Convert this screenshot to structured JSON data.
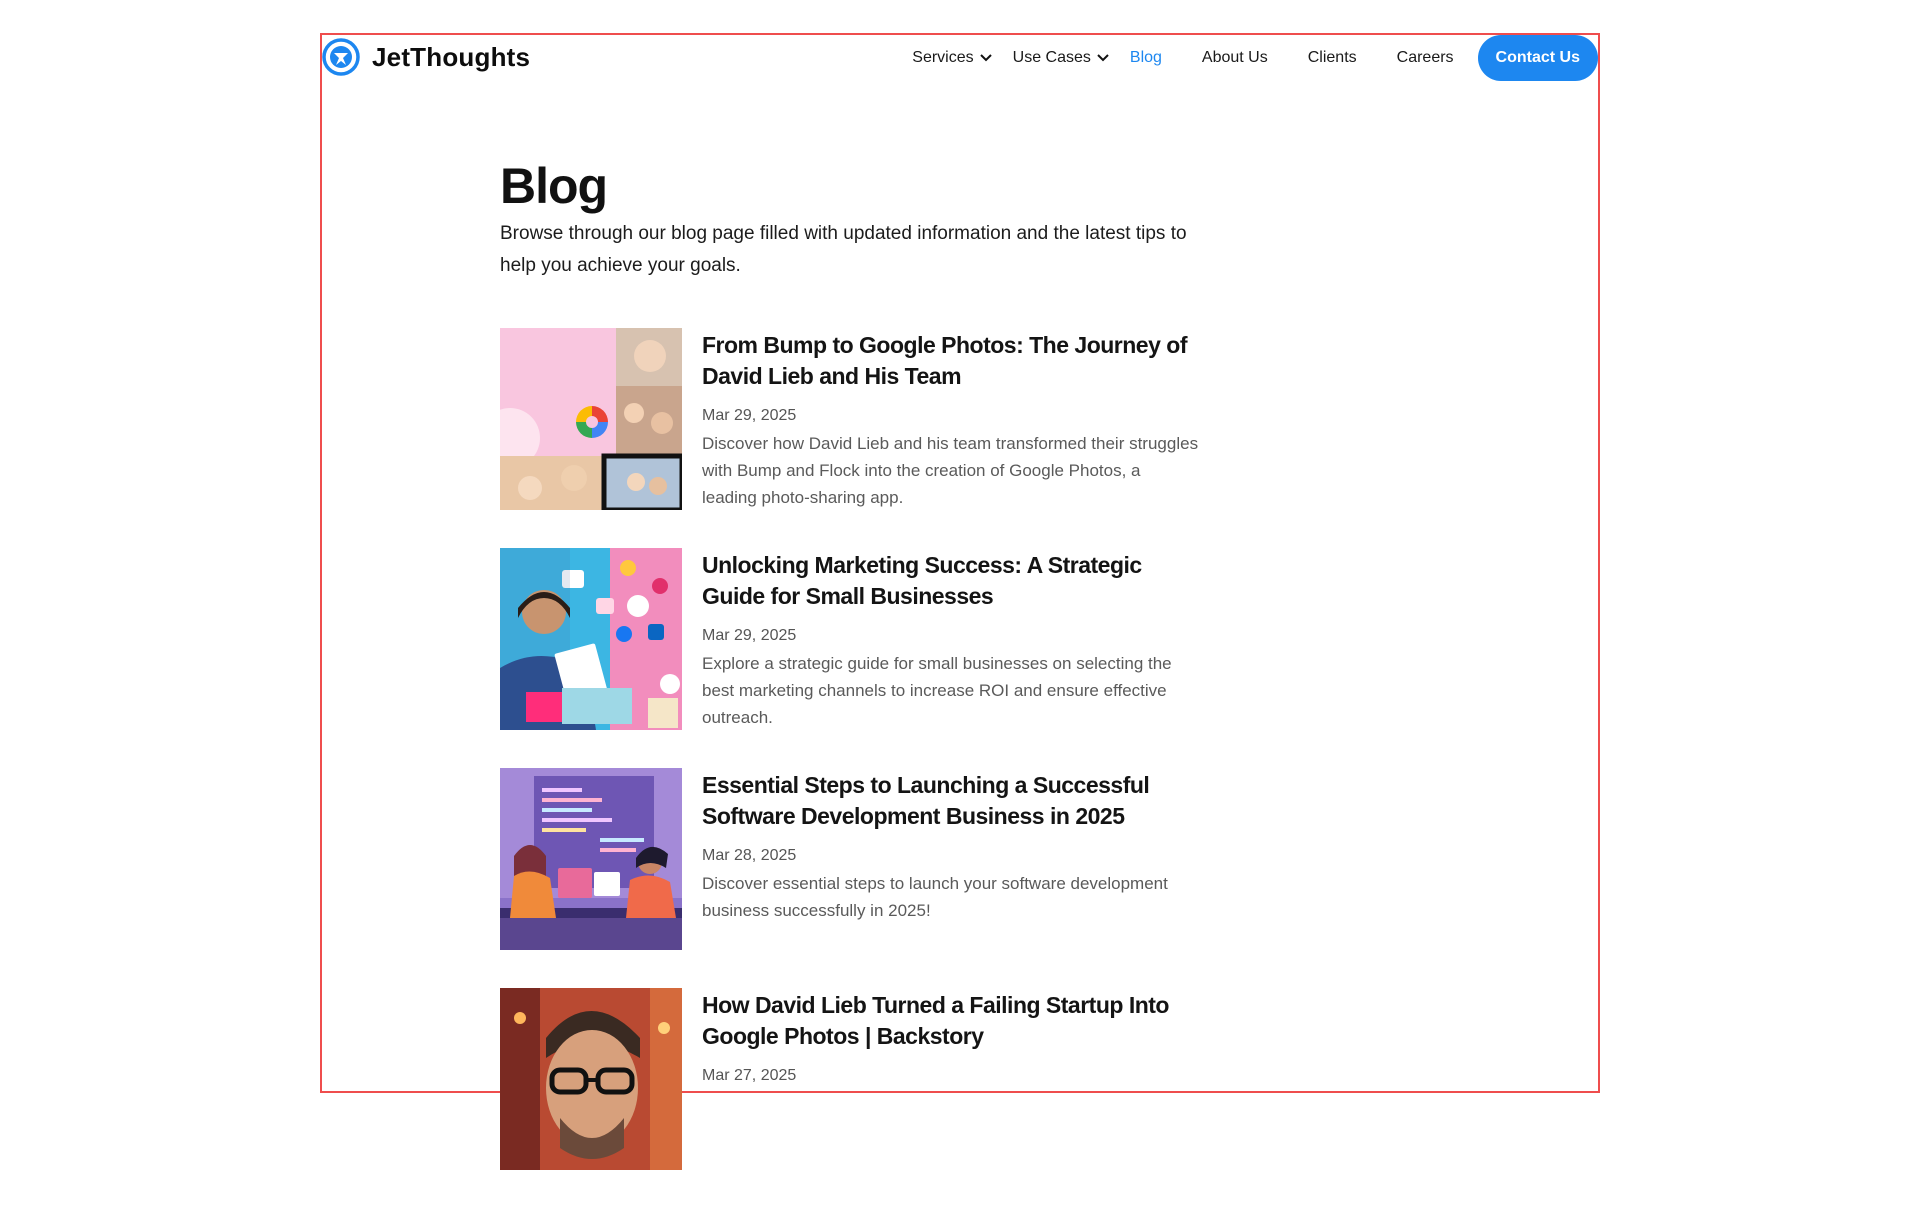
{
  "header": {
    "logo_text": "JetThoughts",
    "nav": [
      {
        "label": "Services",
        "has_dropdown": true
      },
      {
        "label": "Use Cases",
        "has_dropdown": true
      },
      {
        "label": "Blog",
        "active": true
      },
      {
        "label": "About Us"
      },
      {
        "label": "Clients"
      },
      {
        "label": "Careers"
      }
    ],
    "contact_label": "Contact Us"
  },
  "colors": {
    "accent": "#1d87f0",
    "frame_border": "#ef4d4d",
    "text": "#111111",
    "muted": "#5a5a5a"
  },
  "main": {
    "title": "Blog",
    "intro": "Browse through our blog page filled with updated information and the latest tips to help you achieve your goals.",
    "posts": [
      {
        "title": "From Bump to Google Photos: The Journey of David Lieb and His Team",
        "date": "Mar 29, 2025",
        "excerpt": "Discover how David Lieb and his team transformed their struggles with Bump and Flock into the creation of Google Photos, a leading photo-sharing app.",
        "thumb_icon": "google-photos-collage-image"
      },
      {
        "title": "Unlocking Marketing Success: A Strategic Guide for Small Businesses",
        "date": "Mar 29, 2025",
        "excerpt": "Explore a strategic guide for small businesses on selecting the best marketing channels to increase ROI and ensure effective outreach.",
        "thumb_icon": "marketing-woman-social-icons-image"
      },
      {
        "title": "Essential Steps to Launching a Successful Software Development Business in 2025",
        "date": "Mar 28, 2025",
        "excerpt": "Discover essential steps to launch your software development business successfully in 2025!",
        "thumb_icon": "developers-illustration-image"
      },
      {
        "title": "How David Lieb Turned a Failing Startup Into Google Photos | Backstory",
        "date": "Mar 27, 2025",
        "excerpt": "",
        "thumb_icon": "man-with-glasses-portrait-image"
      }
    ]
  }
}
